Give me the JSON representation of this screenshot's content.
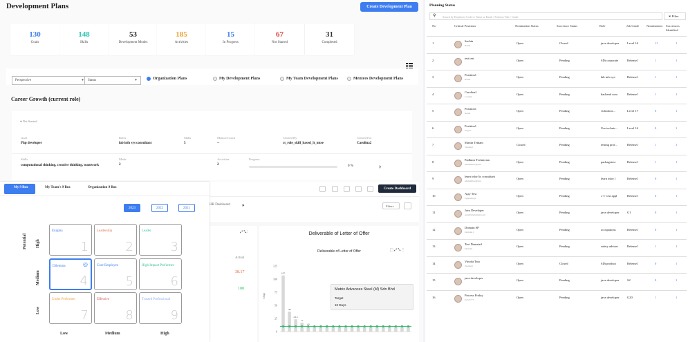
{
  "page_title": "Development Plans",
  "create_button": "Create Development Plan",
  "stats": [
    {
      "num": "130",
      "label": "Goals",
      "color": "#3d7df0"
    },
    {
      "num": "148",
      "label": "Skills",
      "color": "#2ec4b6"
    },
    {
      "num": "53",
      "label": "Development Modes",
      "color": "#222"
    },
    {
      "num": "185",
      "label": "Activities",
      "color": "#f0a030"
    },
    {
      "num": "15",
      "label": "In Progress",
      "color": "#3d7df0"
    },
    {
      "num": "67",
      "label": "Not Started",
      "color": "#e0443e"
    },
    {
      "num": "31",
      "label": "Completed",
      "color": "#333"
    }
  ],
  "filters": {
    "perspective": "Perspective",
    "status": "Status"
  },
  "radios": [
    "Organization Plans",
    "My Development Plans",
    "My Team Development Plans",
    "Mentees Development Plans"
  ],
  "career": {
    "title": "Career Growth (current role)",
    "status": "Not Started",
    "goal_l": "Goal",
    "goal_v": "Php developer",
    "roles_l": "Roles",
    "roles_v": "lab info sys consultant",
    "skills_l": "Skills",
    "skills_v": "5",
    "mentor_l": "Mentor/Coach",
    "mentor_v": "--",
    "cby_l": "Created By",
    "cby_v": "ct_role_skill_based_lt_mtse",
    "cfor_l": "Created For",
    "cfor_v": "Carolina2",
    "skills2_l": "Skills",
    "skills2_v": "computational thinking, creative thinking, teamwork",
    "mode_l": "Mode",
    "mode_v": "2",
    "act_l": "Activities",
    "act_v": "2",
    "prog_l": "Progress",
    "prog_v": "0 %"
  },
  "ninebox": {
    "tabs": [
      "My 9 Box",
      "My Team's 9 Box",
      "Organization 9 Box"
    ],
    "years": [
      "2023",
      "2022",
      "2021"
    ],
    "y_title": "Potential",
    "y_labels": [
      "High",
      "Medium",
      "Low"
    ],
    "x_labels": [
      "Low",
      "Medium",
      "High"
    ],
    "boxes": [
      {
        "name": "Enigma",
        "n": "1",
        "color": "#3d7df0"
      },
      {
        "name": "Leadership",
        "n": "2",
        "color": "#e07050"
      },
      {
        "name": "Leader",
        "n": "3",
        "color": "#2ec4a6"
      },
      {
        "name": "Dilemma",
        "n": "4",
        "color": "#3d7df0"
      },
      {
        "name": "Core Employee",
        "n": "5",
        "color": "#3d7df0"
      },
      {
        "name": "High Impact Performer",
        "n": "6",
        "color": "#2ec48a"
      },
      {
        "name": "Under Performer",
        "n": "7",
        "color": "#f0a030"
      },
      {
        "name": "Effective",
        "n": "8",
        "color": "#e05050"
      },
      {
        "name": "Trusted Professional",
        "n": "9",
        "color": "#8ab0f0"
      }
    ]
  },
  "dashboard": {
    "create_button": "Create Dashboard",
    "tab": "HR Dashboard",
    "filters": "Filters",
    "chart_title": "Deliverable of Letter of Offer",
    "chart_subtitle": "Deliverable of Letter of Offer",
    "actual_label": "Actual",
    "actual_1": "38.17",
    "actual_2": "100",
    "y_label": "Days",
    "tooltip_title": "Matrix Advances Steel (M) Sdn Bhd",
    "tooltip_l1": "Target",
    "tooltip_l2": "10 Days"
  },
  "chart_data": {
    "type": "bar",
    "title": "Deliverable of Letter of Offer",
    "ylabel": "Days",
    "values": [
      107,
      38,
      23.5,
      17,
      10,
      10,
      10,
      10,
      10,
      10,
      10,
      10,
      10,
      10,
      10,
      10,
      10,
      10,
      10,
      10,
      10
    ],
    "target": 10,
    "ylim": [
      0,
      125
    ],
    "yticks": [
      0,
      25,
      50,
      75,
      100,
      125
    ]
  },
  "planning": {
    "title": "Planning Status",
    "search_placeholder": "Search by Employee Code or Name or Email / Position Title / Grade",
    "filter": "Filter",
    "headers": [
      "No",
      "Critical Positions",
      "Nomination Status",
      "Successor Status",
      "Role",
      "Job Grade",
      "Nominations",
      "Successors Identified"
    ],
    "rows": [
      {
        "no": "1",
        "pos": "Sachin",
        "sub": "Retail",
        "nom": "Open",
        "suc": "Closed",
        "role": "java developer",
        "grade": "Level 16",
        "n": "11",
        "s": "1"
      },
      {
        "no": "2",
        "pos": "test test",
        "sub": "",
        "nom": "Open",
        "suc": "Pending",
        "role": "SDt corporate",
        "grade": "Release1",
        "n": "1",
        "s": "1"
      },
      {
        "no": "3",
        "pos": "Position1",
        "sub": "Retail",
        "nom": "Open",
        "suc": "Pending",
        "role": "lab info sys",
        "grade": "Release1",
        "n": "1",
        "s": "1"
      },
      {
        "no": "4",
        "pos": "Carolina1",
        "sub": "Content",
        "nom": "Open",
        "suc": "Pending",
        "role": "backend com",
        "grade": "Release1",
        "n": "1",
        "s": "1"
      },
      {
        "no": "5",
        "pos": "Position1",
        "sub": "Retail",
        "nom": "Open",
        "suc": "Pending",
        "role": "videobots...",
        "grade": "Level 17",
        "n": "0",
        "s": "1"
      },
      {
        "no": "6",
        "pos": "Position1",
        "sub": "Export",
        "nom": "Open",
        "suc": "Pending",
        "role": "Use technic...",
        "grade": "Level 16",
        "n": "0",
        "s": "1"
      },
      {
        "no": "7",
        "pos": "Martin Tetham",
        "sub": "Testing2",
        "nom": "Closed",
        "suc": "Pending",
        "role": "testing prof...",
        "grade": "Release1",
        "n": "1",
        "s": "1"
      },
      {
        "no": "8",
        "pos": "Padhmir Technician",
        "sub": "edtmember@test",
        "nom": "Open",
        "suc": "Pending",
        "role": "packagetest",
        "grade": "Release1",
        "n": "1",
        "s": "1"
      },
      {
        "no": "9",
        "pos": "learn infor lis consultant",
        "sub": "edtmember@test",
        "nom": "Open",
        "suc": "Pending",
        "role": "learn infor l",
        "grade": "Release1",
        "n": "0",
        "s": "1"
      },
      {
        "no": "10",
        "pos": "Ajay Test",
        "sub": "Ppptesting1",
        "nom": "Open",
        "suc": "Pending",
        "role": "c++ test appl",
        "grade": "Release1",
        "n": "0",
        "s": "1"
      },
      {
        "no": "11",
        "pos": "Java Developer",
        "sub": "test2022@gmail.com",
        "nom": "Open",
        "suc": "Pending",
        "role": "java developer",
        "grade": "G1",
        "n": "0",
        "s": "1"
      },
      {
        "no": "12",
        "pos": "Domain SP",
        "sub": "Domain1",
        "nom": "Open",
        "suc": "Pending",
        "role": "occupations",
        "grade": "Release1",
        "n": "0",
        "s": "1"
      },
      {
        "no": "13",
        "pos": "Test Domain1",
        "sub": "Domain",
        "nom": "Open",
        "suc": "Pending",
        "role": "safety adviser",
        "grade": "Release1",
        "n": "1",
        "s": "1"
      },
      {
        "no": "14",
        "pos": "Vinoda Tata",
        "sub": "Testing1",
        "nom": "Open",
        "suc": "Closed",
        "role": "SDt product",
        "grade": "Release1",
        "n": "0",
        "s": "1"
      },
      {
        "no": "15",
        "pos": "java developer",
        "sub": "",
        "nom": "Open",
        "suc": "Pending",
        "role": "java developer",
        "grade": "S2",
        "n": "0",
        "s": "1"
      },
      {
        "no": "16",
        "pos": "Process Friday",
        "sub": "D-SV777",
        "nom": "Open",
        "suc": "Pending",
        "role": "java developer",
        "grade": "G20",
        "n": "1",
        "s": "1"
      }
    ]
  }
}
